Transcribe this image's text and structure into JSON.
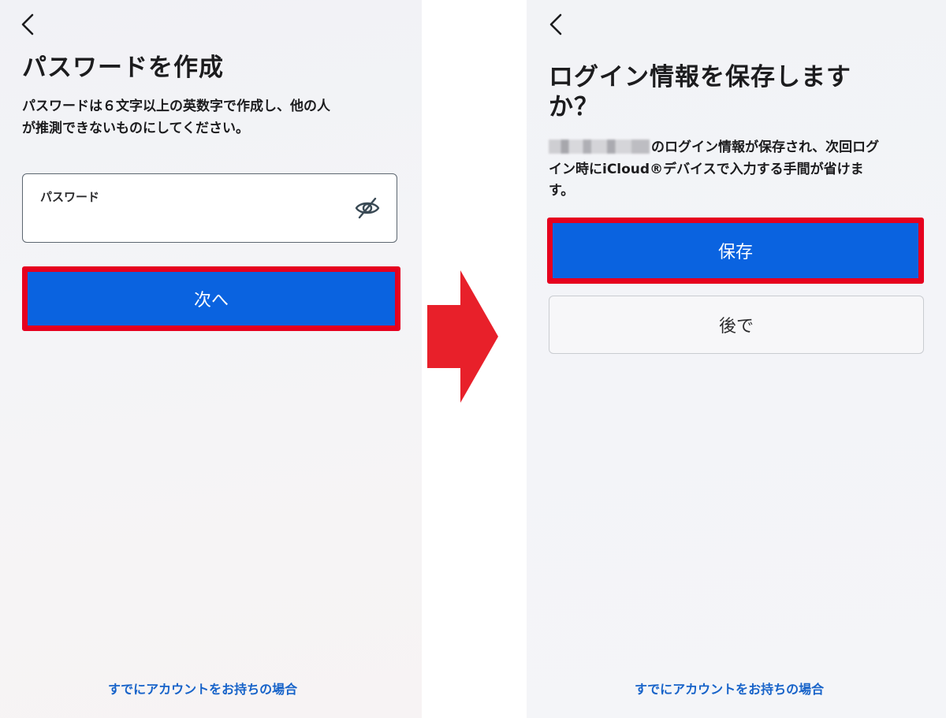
{
  "left_screen": {
    "title": "パスワードを作成",
    "description_line1": "パスワードは６文字以上の英数字で作成し、他の人",
    "description_line2": "が推測できないものにしてください。",
    "password_field_label": "パスワード",
    "password_field_value": "",
    "next_button_label": "次へ",
    "footer_link": "すでにアカウントをお持ちの場合"
  },
  "right_screen": {
    "title_line1": "ログイン情報を保存します",
    "title_line2": "か？",
    "description_line1": "のログイン情報が保存され、次回ログ",
    "description_line2": "イン時にiCloud®デバイスで入力する手間が省けま",
    "description_line3": "す。",
    "save_button_label": "保存",
    "later_button_label": "後で",
    "footer_link": "すでにアカウントをお持ちの場合"
  },
  "colors": {
    "primary_button": "#0a63e0",
    "highlight_border": "#e6001e",
    "arrow": "#e8202a",
    "link": "#1763c9"
  },
  "icons": {
    "back": "chevron-left-icon",
    "password_visibility": "eye-slash-icon",
    "transition": "arrow-right-icon"
  }
}
